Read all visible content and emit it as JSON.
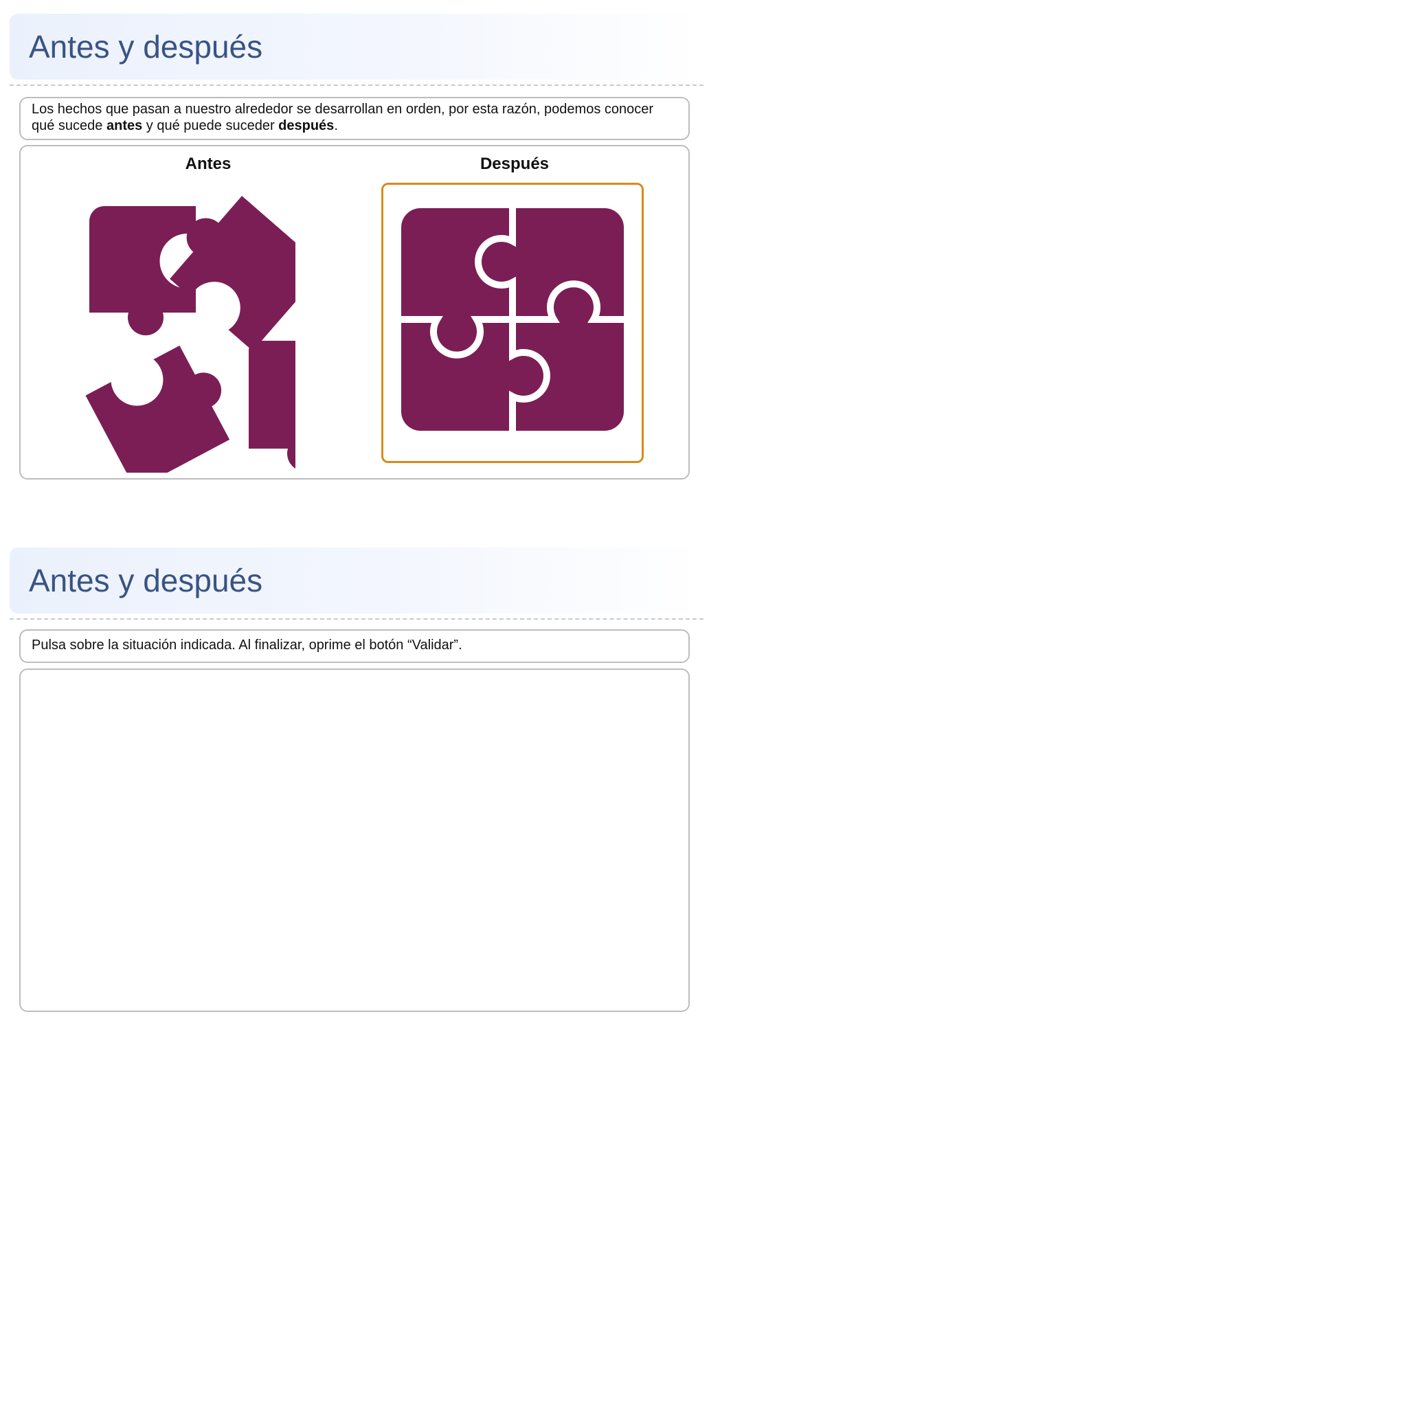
{
  "colors": {
    "accent": "#3a5384",
    "puzzle": "#7b1e55",
    "frame_highlight": "#d98a1b",
    "border": "#bdbdbd"
  },
  "sections": [
    {
      "title": "Antes y después",
      "instruction": {
        "part1": "Los hechos que pasan a nuestro alrededor se desarrollan en orden, por esta razón, podemos conocer qué sucede ",
        "bold1": "antes",
        "part2": " y qué puede suceder ",
        "bold2": "después",
        "part3": "."
      },
      "columns": [
        {
          "label": "Antes",
          "image": "scattered-puzzle-pieces"
        },
        {
          "label": "Después",
          "image": "assembled-puzzle"
        }
      ]
    },
    {
      "title": "Antes y después",
      "instruction": "Pulsa sobre la situación indicada. Al finalizar, oprime el botón “Validar”."
    }
  ]
}
